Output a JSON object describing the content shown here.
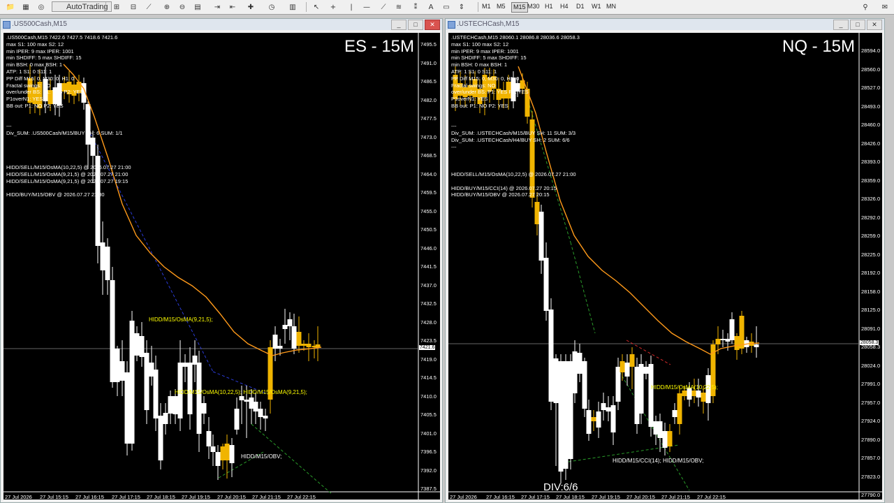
{
  "toolbar": {
    "autotrading_label": "AutoTrading",
    "timeframes": [
      "M1",
      "M5",
      "M15",
      "M30",
      "H1",
      "H4",
      "D1",
      "W1",
      "MN"
    ],
    "active_timeframe": "M15"
  },
  "left": {
    "window_title": ".US500Cash,M15",
    "big_label": "ES - 15M",
    "info_lines": [
      ".US500Cash,M15  7422.6 7427.5 7418.6 7421.6",
      "max S1: 100 max S2: 12",
      "min IPER: 9 max IPER: 1001",
      "min SHDIFF: 5 max SHDIFF: 15",
      "min BSH: 0 max BSH: 1",
      "ATP: 1 S1: 0 S11: 1",
      "PP Diff M15: 0, M30: 0, H1: 0",
      "Fractal swings: NO",
      "over/under BS: P1: YES  P2: YES",
      "P1overN1: YES",
      "BB out: P1: NO  P2: YES",
      "",
      "",
      "---",
      "Div_SUM: .US500Cash/M15/BUY SH: 6 SUM: 1/1",
      "",
      "",
      "",
      "",
      "HIDD/SELL/M15/OsMA(10,22,5) @ 2026.07.27 21:00",
      "HIDD/SELL/M15/OsMA(9,21,5) @ 2026.07.27 21:00",
      "HIDD/SELL/M15/OsMA(9,21,5) @ 2026.07.27 19:15",
      "",
      "HIDD/BUY/M15/OBV @ 2026.07.27 21:30"
    ],
    "price_labels": [
      "7495.5",
      "7491.0",
      "7486.5",
      "7482.0",
      "7477.5",
      "7473.0",
      "7468.5",
      "7464.0",
      "7459.5",
      "7455.0",
      "7450.5",
      "7446.0",
      "7441.5",
      "7437.0",
      "7432.5",
      "7428.0",
      "7423.5",
      "7419.0",
      "7414.5",
      "7410.0",
      "7405.5",
      "7401.0",
      "7396.5",
      "7392.0",
      "7387.5"
    ],
    "current_price": "7421.6",
    "time_labels": [
      "27 Jul 2026",
      "27 Jul 15:15",
      "27 Jul 16:15",
      "27 Jul 17:15",
      "27 Jul 18:15",
      "27 Jul 19:15",
      "27 Jul 20:15",
      "27 Jul 21:15",
      "27 Jul 22:15"
    ],
    "annotations": [
      "HIDD/M15/OsMA(9,21,5);",
      "HIDD/M15/OsMA(10,22,5); HIDD/M15/OsMA(9,21,5);",
      "HIDD/M15/OBV;"
    ]
  },
  "right": {
    "window_title": ".USTECHCash,M15",
    "big_label": "NQ - 15M",
    "info_lines": [
      ".USTECHCash,M15  28060.1 28086.8 28036.6 28058.3",
      "max S1: 100 max S2: 12",
      "min IPER: 9 max IPER: 1001",
      "min SHDIFF: 5 max SHDIFF: 15",
      "min BSH: 0 max BSH: 1",
      "ATP: 1 S1: 0 S11: 1",
      "PP Diff M15: 0, M30: 0, H1: 0",
      "Fractal swings: NO",
      "over/under BS: P1: YES  P2: YES",
      "P1overN1: YES",
      "BB out: P1: NO  P2: YES",
      "",
      "",
      "---",
      "Div_SUM: .USTECHCash/M15/BUY SH: 11 SUM: 3/3",
      "Div_SUM: .USTECHCash/H4/BUY SH: 2 SUM: 6/6",
      "---",
      "",
      "",
      "",
      "HIDD/SELL/M15/OsMA(10,22,5) @ 2026.07.27 21:00",
      "",
      "HIDD/BUY/M15/CCI(14) @ 2026.07.27 20:15",
      "HIDD/BUY/M15/OBV @ 2026.07.27 20:15"
    ],
    "price_labels": [
      "28594.0",
      "28560.0",
      "28527.0",
      "28493.0",
      "28460.0",
      "28426.0",
      "28393.0",
      "28359.0",
      "28326.0",
      "28292.0",
      "28259.0",
      "28225.0",
      "28192.0",
      "28158.0",
      "28125.0",
      "28091.0",
      "28058.3",
      "28024.0",
      "27991.0",
      "27957.0",
      "27924.0",
      "27890.0",
      "27857.0",
      "27823.0",
      "27790.0"
    ],
    "current_price": "28058.3",
    "time_labels": [
      "27 Jul 2026",
      "27 Jul 16:15",
      "27 Jul 17:15",
      "27 Jul 18:15",
      "27 Jul 19:15",
      "27 Jul 20:15",
      "27 Jul 21:15",
      "27 Jul 22:15"
    ],
    "annotations": [
      "HIDD/M15/OsMA(10,22,5);",
      "HIDD/M15/CCI(14); HIDD/M15/OBV;"
    ],
    "div_label": "DIV:6/6"
  },
  "colors": {
    "bull": "#ffffff",
    "bear": "#f0b400",
    "ma": "#ff9a1a",
    "annotation": "#ffff00"
  }
}
